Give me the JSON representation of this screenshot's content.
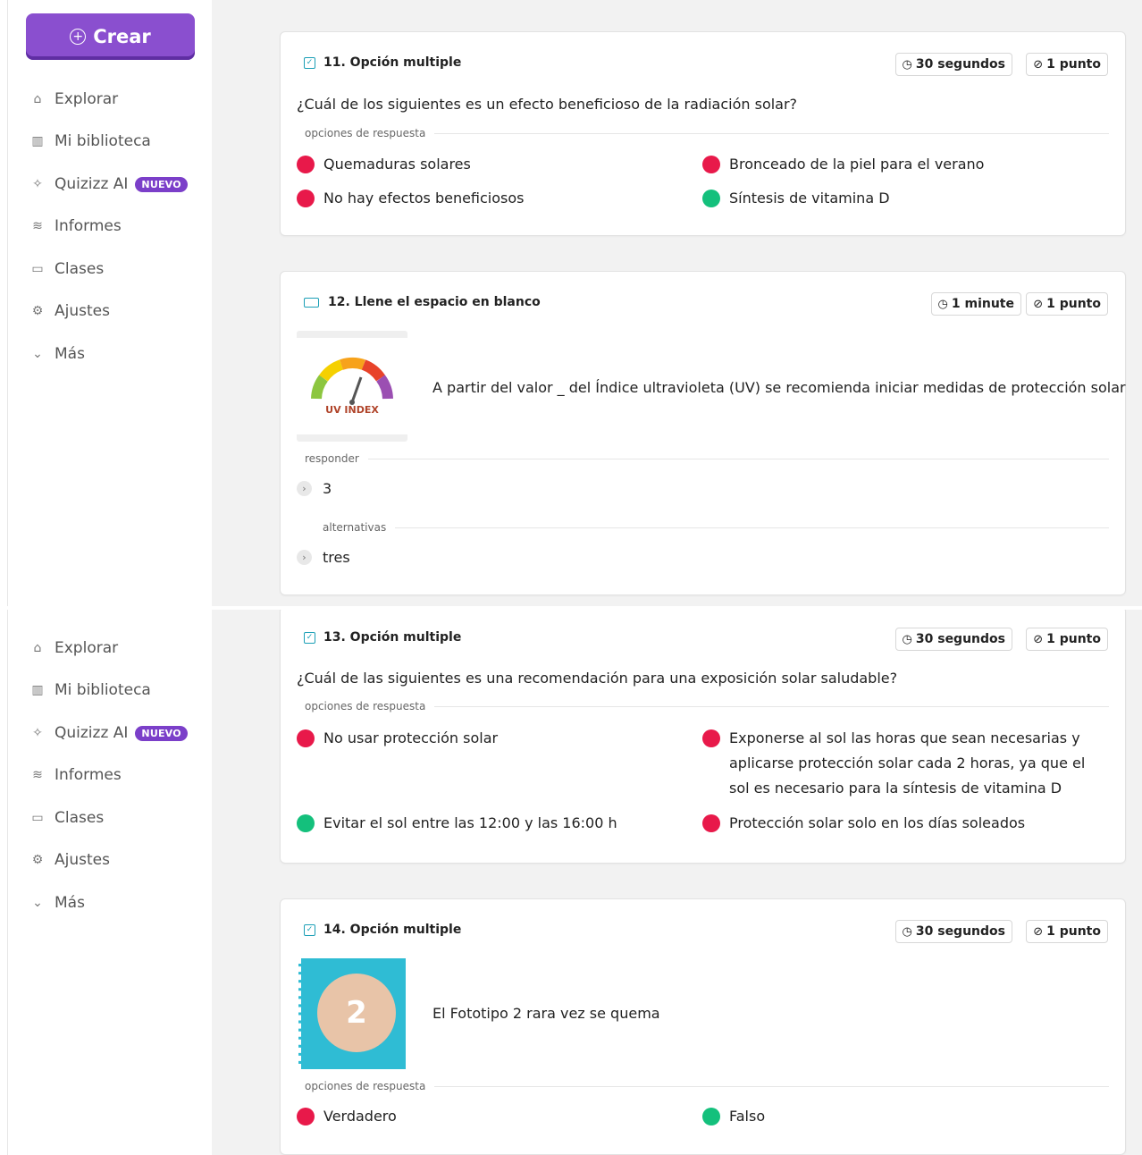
{
  "sidebar": {
    "create_label": "Crear",
    "items": [
      {
        "label": "Explorar",
        "icon": "explore-icon"
      },
      {
        "label": "Mi biblioteca",
        "icon": "library-icon"
      },
      {
        "label": "Quizizz AI",
        "icon": "sparkle-icon",
        "badge": "NUEVO"
      },
      {
        "label": "Informes",
        "icon": "reports-icon"
      },
      {
        "label": "Clases",
        "icon": "classes-icon"
      },
      {
        "label": "Ajustes",
        "icon": "settings-icon"
      },
      {
        "label": "Más",
        "icon": "chevron-down-icon"
      }
    ]
  },
  "questions": [
    {
      "type_label": "11. Opción multiple",
      "time": "30 segundos",
      "points": "1 punto",
      "text": "¿Cuál de los siguientes es un efecto beneficioso de la radiación solar?",
      "section_label": "opciones de respuesta",
      "options": [
        {
          "text": "Quemaduras solares",
          "correct": false
        },
        {
          "text": "Bronceado de la piel para el verano",
          "correct": false
        },
        {
          "text": "No hay efectos beneficiosos",
          "correct": false
        },
        {
          "text": "Síntesis de vitamina D",
          "correct": true
        }
      ]
    },
    {
      "type_label": "12. Llene el espacio en blanco",
      "time": "1 minute",
      "points": "1 punto",
      "image_label": "UV INDEX",
      "text": "A partir del valor _ del Índice ultravioleta (UV) se recomienda iniciar medidas de protección solar",
      "answer_label": "responder",
      "answer": "3",
      "alternatives_label": "alternativas",
      "alternative": "tres"
    },
    {
      "type_label": "13. Opción multiple",
      "time": "30 segundos",
      "points": "1 punto",
      "text": "¿Cuál de las siguientes es una recomendación para una exposición solar saludable?",
      "section_label": "opciones de respuesta",
      "options": [
        {
          "text": "No usar protección solar",
          "correct": false
        },
        {
          "text": "Exponerse al sol las horas que sean necesarias y aplicarse protección solar cada 2 horas, ya que el sol es necesario para la síntesis de vitamina D",
          "correct": false
        },
        {
          "text": "Evitar el sol entre las 12:00 y las 16:00 h",
          "correct": true
        },
        {
          "text": "Protección solar solo en los días soleados",
          "correct": false
        }
      ]
    },
    {
      "type_label": "14. Opción multiple",
      "time": "30 segundos",
      "points": "1 punto",
      "image_label": "2",
      "text": "El Fototipo 2 rara vez se quema",
      "section_label": "opciones de respuesta",
      "options": [
        {
          "text": "Verdadero",
          "correct": false
        },
        {
          "text": "Falso",
          "correct": true
        }
      ]
    }
  ],
  "colors": {
    "accent": "#8a4fcf",
    "correct": "#14c07c",
    "incorrect": "#e8194a",
    "badge": "#7b3fc9"
  }
}
